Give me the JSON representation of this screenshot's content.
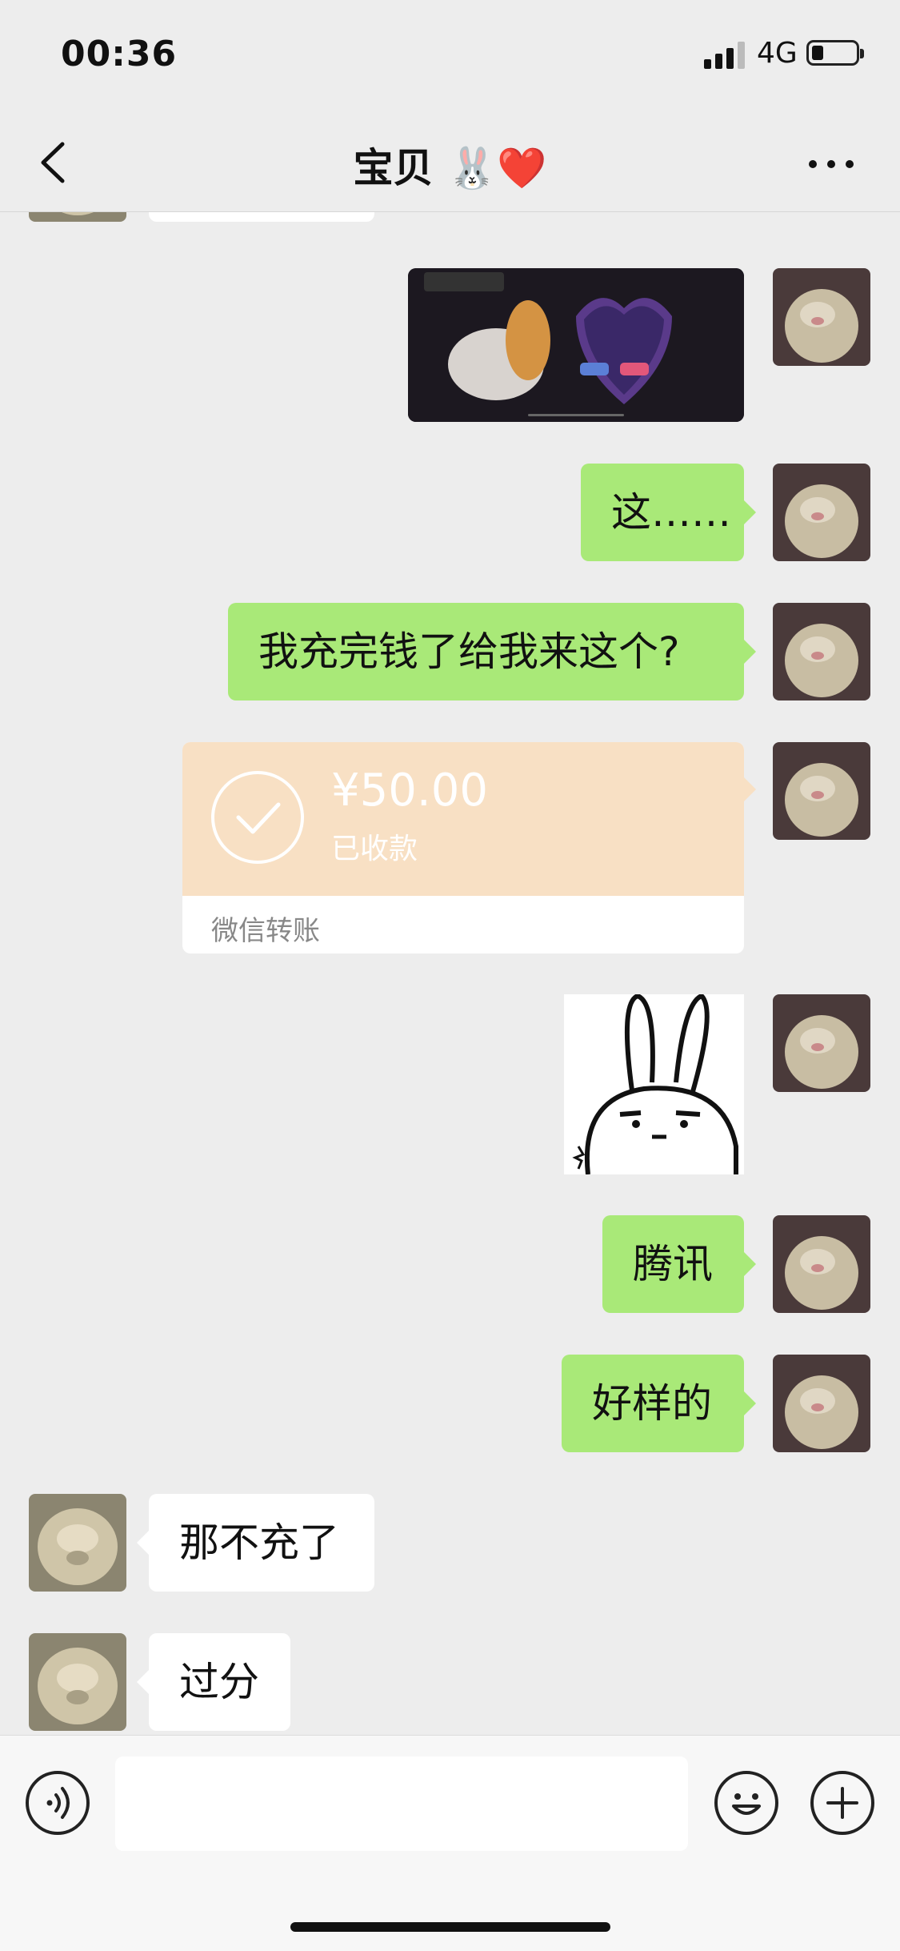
{
  "status_bar": {
    "time": "00:36",
    "network": "4G",
    "battery_percent": 25
  },
  "nav": {
    "title": "宝贝",
    "title_emoji": "🐰❤️"
  },
  "messages": [
    {
      "sender": "me",
      "type": "image"
    },
    {
      "sender": "me",
      "type": "text",
      "text": "这……"
    },
    {
      "sender": "me",
      "type": "text",
      "text": "我充完钱了给我来这个?"
    },
    {
      "sender": "me",
      "type": "transfer",
      "amount": "¥50.00",
      "status": "已收款",
      "label": "微信转账"
    },
    {
      "sender": "me",
      "type": "sticker"
    },
    {
      "sender": "me",
      "type": "text",
      "text": "腾讯"
    },
    {
      "sender": "me",
      "type": "text",
      "text": "好样的"
    },
    {
      "sender": "them",
      "type": "text",
      "text": "那不充了"
    },
    {
      "sender": "them",
      "type": "text",
      "text": "过分"
    }
  ],
  "input": {
    "value": "",
    "placeholder": ""
  },
  "icons": {
    "back": "chevron-left-icon",
    "more": "more-dots-icon",
    "voice": "voice-icon",
    "emoji": "emoji-icon",
    "plus": "plus-icon"
  },
  "colors": {
    "sent_bubble": "#a9e978",
    "received_bubble": "#ffffff",
    "transfer_card": "#f8e0c4",
    "background": "#ededed"
  }
}
